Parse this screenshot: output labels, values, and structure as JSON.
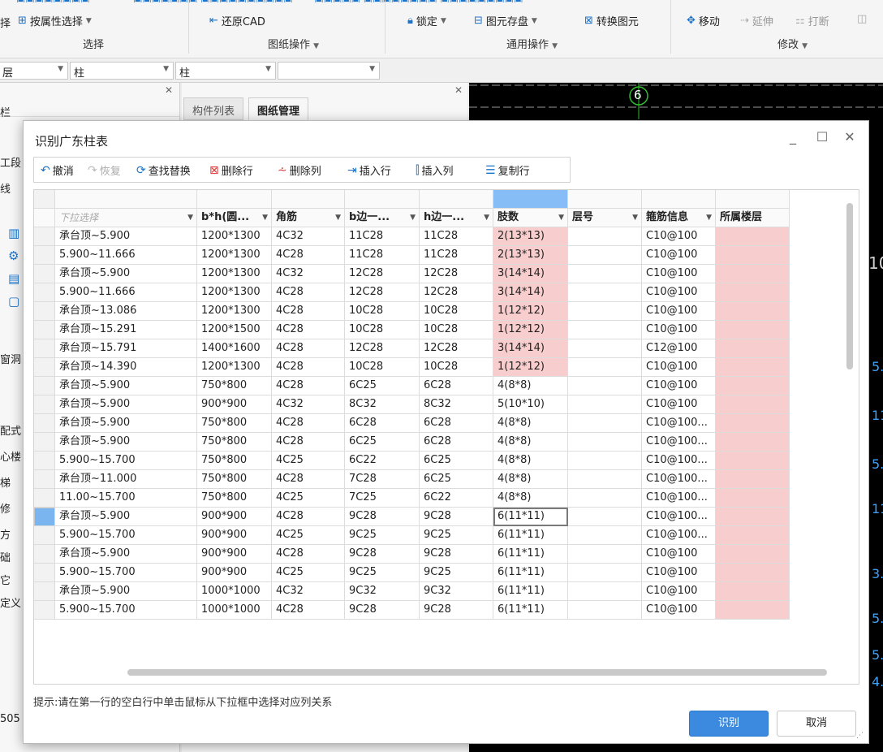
{
  "ribbon": {
    "row1": {
      "attr_select": "按属性选择",
      "restore_cad": "还原CAD",
      "lock": "锁定",
      "element_save": "图元存盘",
      "convert_element": "转换图元",
      "move": "移动",
      "extend": "延伸",
      "break": "打断"
    },
    "groups": {
      "select": "选择",
      "drawing_ops": "图纸操作",
      "common_ops": "通用操作",
      "modify": "修改"
    },
    "left_fragment": "择"
  },
  "selectors": {
    "s0": "层",
    "s1": "柱",
    "s2": "柱",
    "s3": ""
  },
  "left_panel": {
    "header_fragment": "栏",
    "items": [
      "工段",
      "线",
      "窗洞",
      "配式",
      "心楼",
      "梯",
      "修",
      "方",
      "础",
      "它",
      "定义"
    ],
    "bottom_fragment": "505"
  },
  "mid_panel": {
    "tabs": [
      "构件列表",
      "图纸管理"
    ]
  },
  "cad": {
    "axis_label": "6",
    "edge_texts": [
      "10",
      "5.",
      "11",
      "5.",
      "11",
      "3.",
      "5.",
      "5.",
      "4."
    ]
  },
  "dialog": {
    "title": "识别广东柱表",
    "toolbar": {
      "undo": "撤消",
      "redo": "恢复",
      "find_replace": "查找替换",
      "delete_row": "删除行",
      "delete_col": "删除列",
      "insert_row": "插入行",
      "insert_col": "插入列",
      "copy_row": "复制行"
    },
    "header_placeholder": "下拉选择",
    "columns": [
      "b*h(圆...",
      "角筋",
      "b边一...",
      "h边一...",
      "肢数",
      "层号",
      "箍筋信息",
      "所属楼层"
    ],
    "rows": [
      [
        "承台顶~5.900",
        "1200*1300",
        "4C32",
        "11C28",
        "11C28",
        "2(13*13)",
        "",
        "C10@100",
        ""
      ],
      [
        "5.900~11.666",
        "1200*1300",
        "4C28",
        "11C28",
        "11C28",
        "2(13*13)",
        "",
        "C10@100",
        ""
      ],
      [
        "承台顶~5.900",
        "1200*1300",
        "4C32",
        "12C28",
        "12C28",
        "3(14*14)",
        "",
        "C10@100",
        ""
      ],
      [
        "5.900~11.666",
        "1200*1300",
        "4C28",
        "12C28",
        "12C28",
        "3(14*14)",
        "",
        "C10@100",
        ""
      ],
      [
        "承台顶~13.086",
        "1200*1300",
        "4C28",
        "10C28",
        "10C28",
        "1(12*12)",
        "",
        "C10@100",
        ""
      ],
      [
        "承台顶~15.291",
        "1200*1500",
        "4C28",
        "10C28",
        "10C28",
        "1(12*12)",
        "",
        "C10@100",
        ""
      ],
      [
        "承台顶~15.791",
        "1400*1600",
        "4C28",
        "12C28",
        "12C28",
        "3(14*14)",
        "",
        "C12@100",
        ""
      ],
      [
        "承台顶~14.390",
        "1200*1300",
        "4C28",
        "10C28",
        "10C28",
        "1(12*12)",
        "",
        "C10@100",
        ""
      ],
      [
        "承台顶~5.900",
        "750*800",
        "4C28",
        "6C25",
        "6C28",
        "4(8*8)",
        "",
        "C10@100",
        ""
      ],
      [
        "承台顶~5.900",
        "900*900",
        "4C32",
        "8C32",
        "8C32",
        "5(10*10)",
        "",
        "C10@100",
        ""
      ],
      [
        "承台顶~5.900",
        "750*800",
        "4C28",
        "6C28",
        "6C28",
        "4(8*8)",
        "",
        "C10@100...",
        ""
      ],
      [
        "承台顶~5.900",
        "750*800",
        "4C28",
        "6C25",
        "6C28",
        "4(8*8)",
        "",
        "C10@100...",
        ""
      ],
      [
        "5.900~15.700",
        "750*800",
        "4C25",
        "6C22",
        "6C25",
        "4(8*8)",
        "",
        "C10@100...",
        ""
      ],
      [
        "承台顶~11.000",
        "750*800",
        "4C28",
        "7C28",
        "6C25",
        "4(8*8)",
        "",
        "C10@100...",
        ""
      ],
      [
        "11.00~15.700",
        "750*800",
        "4C25",
        "7C25",
        "6C22",
        "4(8*8)",
        "",
        "C10@100...",
        ""
      ],
      [
        "承台顶~5.900",
        "900*900",
        "4C28",
        "9C28",
        "9C28",
        "6(11*11)",
        "",
        "C10@100...",
        ""
      ],
      [
        "5.900~15.700",
        "900*900",
        "4C25",
        "9C25",
        "9C25",
        "6(11*11)",
        "",
        "C10@100...",
        ""
      ],
      [
        "承台顶~5.900",
        "900*900",
        "4C28",
        "9C28",
        "9C28",
        "6(11*11)",
        "",
        "C10@100",
        ""
      ],
      [
        "5.900~15.700",
        "900*900",
        "4C25",
        "9C25",
        "9C25",
        "6(11*11)",
        "",
        "C10@100",
        ""
      ],
      [
        "承台顶~5.900",
        "1000*1000",
        "4C32",
        "9C32",
        "9C32",
        "6(11*11)",
        "",
        "C10@100",
        ""
      ],
      [
        "5.900~15.700",
        "1000*1000",
        "4C28",
        "9C28",
        "9C28",
        "6(11*11)",
        "",
        "C10@100",
        ""
      ]
    ],
    "hint": "提示:请在第一行的空白行中单击鼠标从下拉框中选择对应列关系",
    "buttons": {
      "recognize": "识别",
      "cancel": "取消"
    }
  },
  "colors": {
    "accent": "#3b8ae0",
    "pink_cell": "#f8cdcd",
    "blue_header": "#86bdf6",
    "cad_background": "#000000",
    "axis_green": "#2fbf2f"
  }
}
